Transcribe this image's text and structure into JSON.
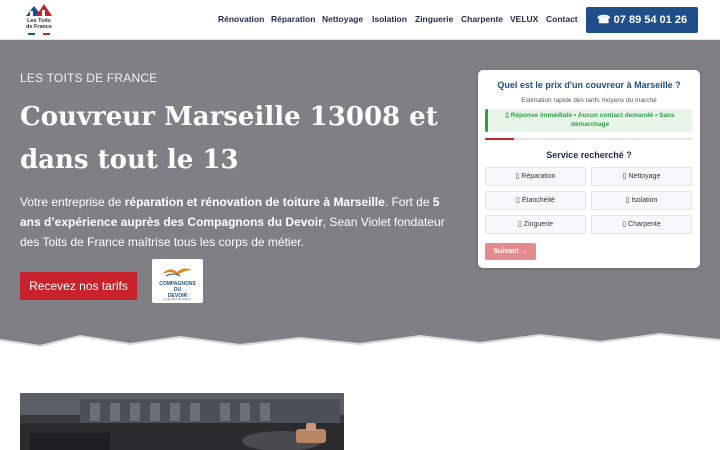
{
  "header": {
    "logo_line1": "Les Toits",
    "logo_line2": "de France",
    "nav": [
      "Rénovation",
      "Réparation",
      "Nettoyage",
      "Isolation",
      "Zinguerie",
      "Charpente",
      "VELUX",
      "Contact"
    ],
    "phone": "☎ 07 89 54 01 26"
  },
  "hero": {
    "kicker": "LES TOITS DE FRANCE",
    "title": "Couvreur Marseille 13008 et dans tout le 13",
    "desc_part1": "Votre entreprise de ",
    "desc_bold1": "réparation et rénovation de toiture à Marseille",
    "desc_part2": ". Fort de ",
    "desc_bold2": "5 ans d’expérience auprès des Compagnons du Devoir",
    "desc_part3": ", Sean Violet fondateur des Toits de France maîtrise tous les corps de métier.",
    "cta": "Recevez nos tarifs",
    "badge_line1": "COMPAGNONS",
    "badge_line2": "DU",
    "badge_line3": "DEVOIR",
    "badge_small": "et du Tour de France"
  },
  "form": {
    "title": "Quel est le prix d'un couvreur à Marseille ?",
    "subtitle": "Estimation rapide des tarifs moyens du marché",
    "alert": "▯ Réponse immédiate • Aucun contact demandé • Sans démarchage",
    "progress": 0.14,
    "service_title": "Service recherché ?",
    "options": [
      "▯ Réparation",
      "▯ Nettoyage",
      "▯ Étanchéité",
      "▯ Isolation",
      "▯ Zinguerie",
      "▯ Charpente"
    ],
    "next": "Suivant →"
  },
  "colors": {
    "brand_blue": "#1f4f8a",
    "cta_red": "#c8232c",
    "hero_gray": "#7f7f86",
    "success_green": "#2e9e4a"
  }
}
